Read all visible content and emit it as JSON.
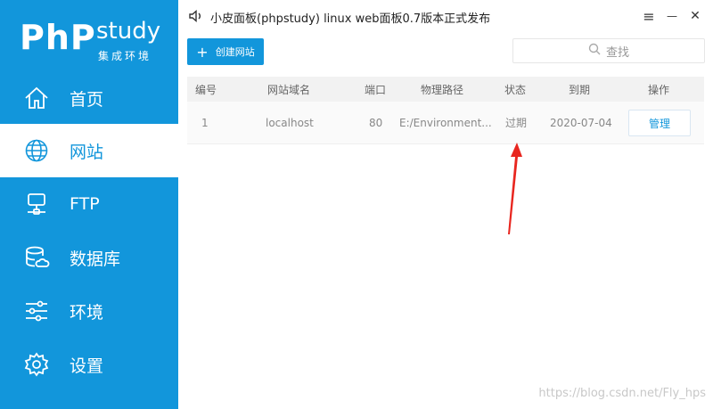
{
  "logo": {
    "php": "PhP",
    "study": "study",
    "sub": "集成环境"
  },
  "sidebar": {
    "items": [
      {
        "label": "首页",
        "icon": "home-icon"
      },
      {
        "label": "网站",
        "icon": "globe-icon"
      },
      {
        "label": "FTP",
        "icon": "ftp-server-icon"
      },
      {
        "label": "数据库",
        "icon": "database-icon"
      },
      {
        "label": "环境",
        "icon": "sliders-icon"
      },
      {
        "label": "设置",
        "icon": "gear-icon"
      }
    ],
    "active_index": 1
  },
  "titlebar": {
    "title": "小皮面板(phpstudy) linux web面板0.7版本正式发布",
    "menu_glyph": "≡",
    "minimize_glyph": "—",
    "close_glyph": "✕"
  },
  "toolbar": {
    "create_label": "创建网站",
    "search_placeholder": "查找"
  },
  "table": {
    "headers": [
      "编号",
      "网站域名",
      "端口",
      "物理路径",
      "状态",
      "到期",
      "操作"
    ],
    "rows": [
      {
        "id": "1",
        "domain": "localhost",
        "port": "80",
        "path": "E:/Environment...",
        "status": "过期",
        "expire": "2020-07-04",
        "action": "管理"
      }
    ]
  },
  "watermark": "https://blog.csdn.net/Fly_hps",
  "colors": {
    "brand": "#1296db",
    "arrow": "#e8261f"
  }
}
